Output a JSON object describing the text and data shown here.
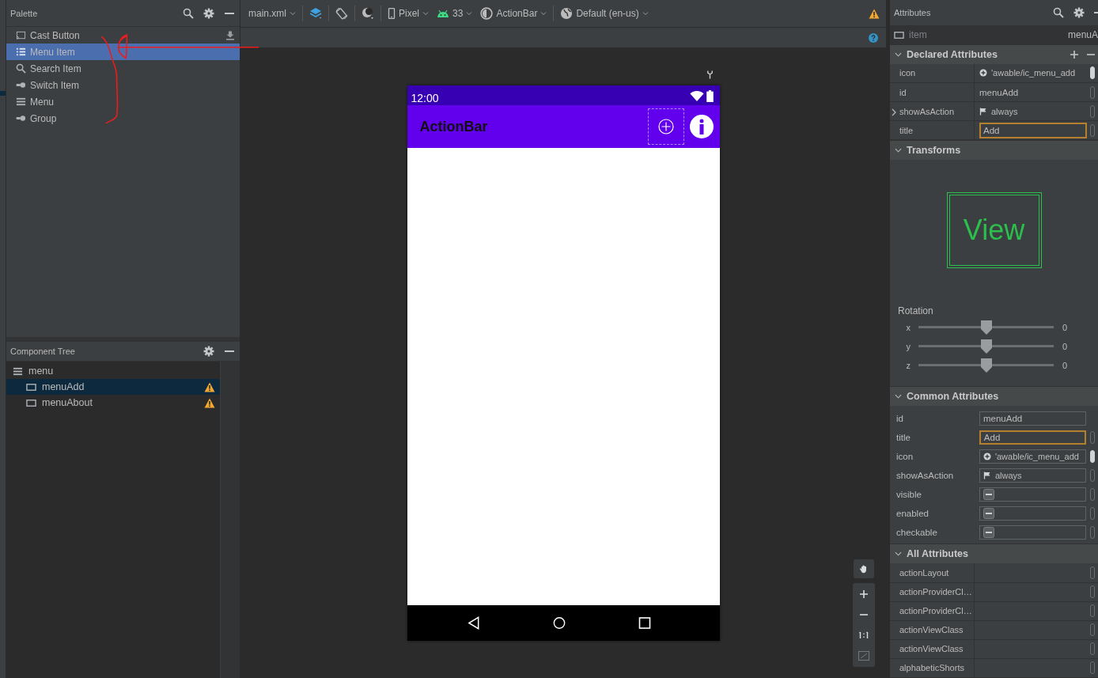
{
  "palette": {
    "title": "Palette",
    "items": [
      {
        "kind": "cast",
        "label": "Cast Button",
        "selected": false,
        "download": true
      },
      {
        "kind": "list",
        "label": "Menu Item",
        "selected": true,
        "download": false
      },
      {
        "kind": "search",
        "label": "Search Item",
        "selected": false,
        "download": false
      },
      {
        "kind": "switch",
        "label": "Switch Item",
        "selected": false,
        "download": false
      },
      {
        "kind": "menu",
        "label": "Menu",
        "selected": false,
        "download": false
      },
      {
        "kind": "switch",
        "label": "Group",
        "selected": false,
        "download": false
      }
    ]
  },
  "component_tree": {
    "title": "Component Tree",
    "items": [
      {
        "label": "menu",
        "kind": "menu",
        "selected": false,
        "warning": false,
        "children": [
          {
            "label": "menuAdd",
            "kind": "item",
            "selected": true,
            "warning": true
          },
          {
            "label": "menuAbout",
            "kind": "item",
            "selected": false,
            "warning": true
          }
        ]
      }
    ]
  },
  "toolbar": {
    "items": [
      {
        "kind": "file",
        "label": "main.xml"
      },
      {
        "kind": "layers"
      },
      {
        "kind": "rotate"
      },
      {
        "kind": "night"
      },
      {
        "kind": "device",
        "label": "Pixel"
      },
      {
        "kind": "api",
        "label": "33"
      },
      {
        "kind": "theme",
        "label": "ActionBar"
      },
      {
        "kind": "locale",
        "label": "Default (en-us)"
      }
    ]
  },
  "phone": {
    "time": "12:00",
    "app_title": "ActionBar",
    "actions": [
      {
        "kind": "add",
        "selected": true
      },
      {
        "kind": "info",
        "selected": false
      }
    ]
  },
  "attributes": {
    "title": "Attributes",
    "component": "item",
    "component_id": "menuA",
    "declared": {
      "title": "Declared Attributes",
      "rows": [
        {
          "name": "icon",
          "value": "'awable/ic_menu_add",
          "kind": "icon"
        },
        {
          "name": "id",
          "value": "menuAdd",
          "kind": "text"
        },
        {
          "name": "showAsAction",
          "value": "always",
          "kind": "flag",
          "expanded": false
        },
        {
          "name": "title",
          "value": "Add",
          "kind": "field",
          "focused": true
        }
      ]
    },
    "transforms": {
      "title": "Transforms",
      "preview": "View",
      "rotation_label": "Rotation",
      "sliders": [
        {
          "axis": "x",
          "level": 0.5,
          "reading": "0"
        },
        {
          "axis": "y",
          "level": 0.5,
          "reading": "0"
        },
        {
          "axis": "z",
          "level": 0.5,
          "reading": "0"
        }
      ]
    },
    "common": {
      "title": "Common Attributes",
      "rows": [
        {
          "name": "id",
          "value": "menuAdd",
          "kind": "field",
          "focused": false
        },
        {
          "name": "title",
          "value": "Add",
          "kind": "field",
          "focused": true
        },
        {
          "name": "icon",
          "value": "'awable/ic_menu_add",
          "kind": "icon",
          "focused": false
        },
        {
          "name": "showAsAction",
          "value": "always",
          "kind": "flag",
          "focused": false
        },
        {
          "name": "visible",
          "kind": "tristate",
          "focused": false
        },
        {
          "name": "enabled",
          "kind": "tristate",
          "focused": false
        },
        {
          "name": "checkable",
          "kind": "tristate",
          "focused": false
        }
      ]
    },
    "all": {
      "title": "All Attributes",
      "rows": [
        "actionLayout",
        "actionProviderCl…",
        "actionProviderCl…",
        "actionViewClass",
        "actionViewClass",
        "alphabeticShorts"
      ]
    }
  }
}
